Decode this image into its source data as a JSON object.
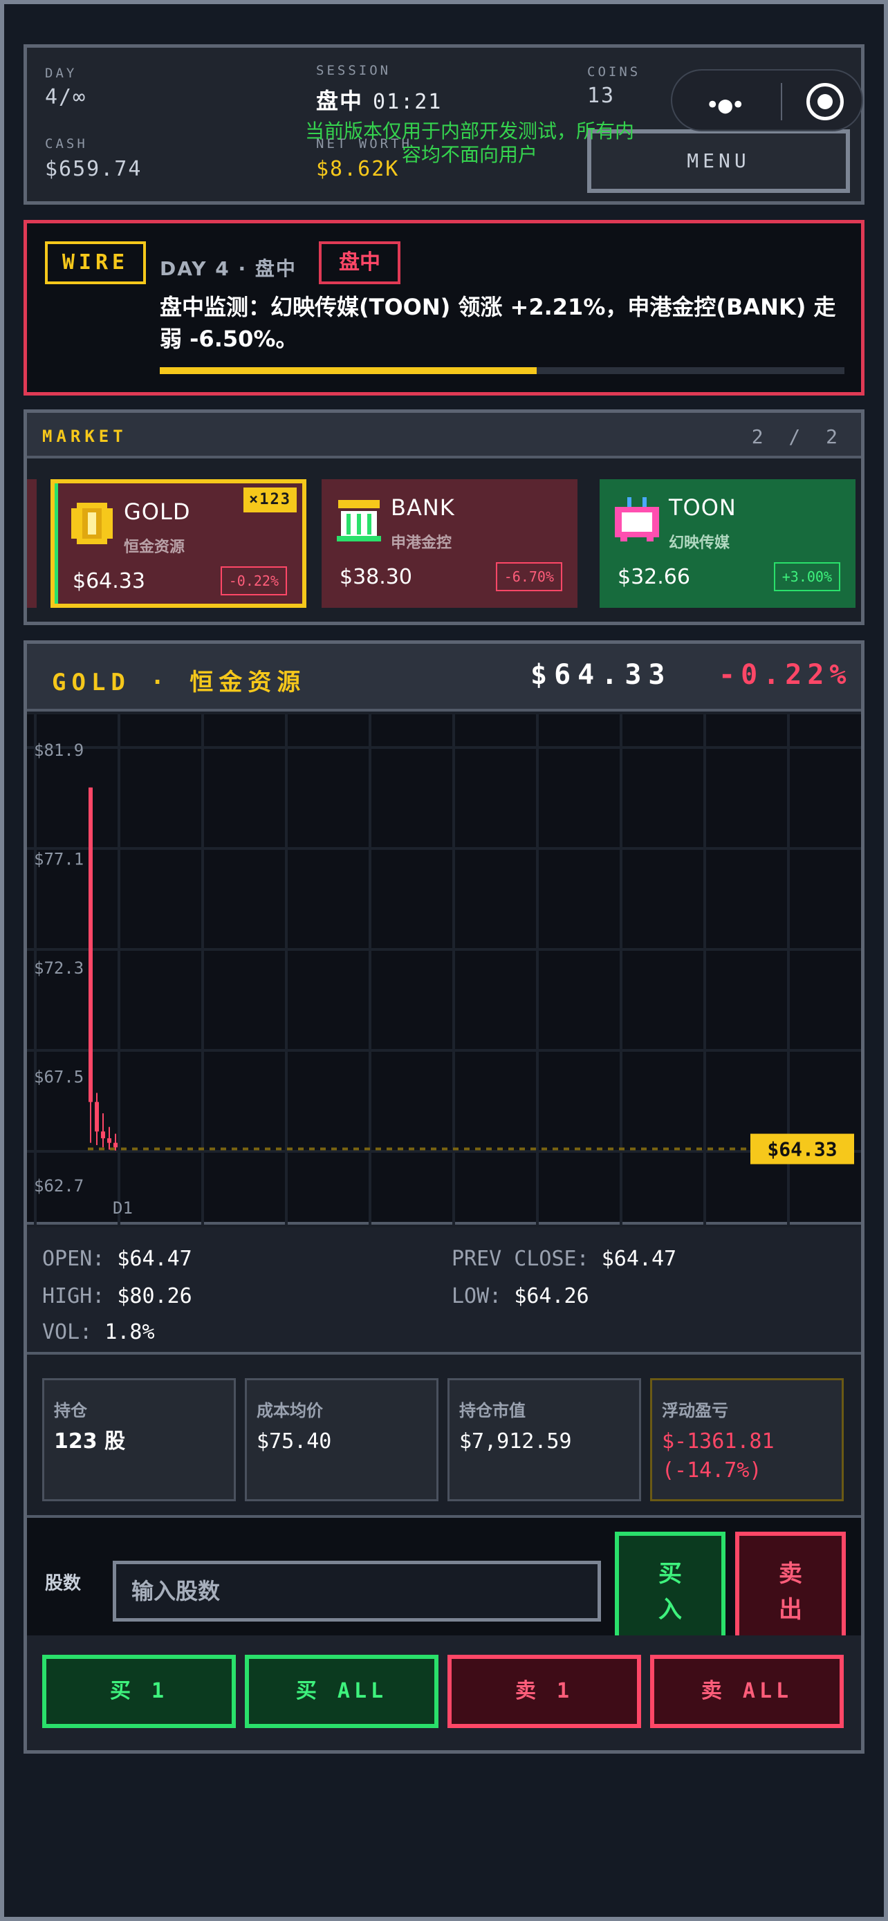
{
  "status": {
    "day_label": "DAY",
    "day_value": "4/∞",
    "session_label": "SESSION",
    "session_value": "盘中",
    "clock": "01:21",
    "coins_label": "COINS",
    "coins_value": "13",
    "cash_label": "CASH",
    "cash_value": "$659.74",
    "networth_label": "NET WORTH",
    "networth_value": "$8.62K",
    "menu_label": "MENU",
    "dev_note": "当前版本仅用于内部开发测试，所有内容均不面向用户"
  },
  "wire": {
    "tag": "WIRE",
    "day": "DAY 4 · 盘中",
    "session_badge": "盘中",
    "message": "盘中监测：幻映传媒(TOON) 领涨 +2.21%，申港金控(BANK) 走弱 -6.50%。",
    "progress": 0.55
  },
  "market": {
    "title": "MARKET",
    "page": "2 / 2",
    "cards": [
      {
        "symbol": "GOLD",
        "name": "恒金资源",
        "price": "$64.33",
        "change": "-0.22%",
        "qty": "×123",
        "icon": "gold-coin-icon"
      },
      {
        "symbol": "BANK",
        "name": "申港金控",
        "price": "$38.30",
        "change": "-6.70%",
        "icon": "bank-building-icon"
      },
      {
        "symbol": "TOON",
        "name": "幻映传媒",
        "price": "$32.66",
        "change": "+3.00%",
        "icon": "tv-icon"
      }
    ]
  },
  "stock": {
    "title": "GOLD · 恒金资源",
    "price": "$64.33",
    "change": "-0.22%",
    "open_label": "OPEN:",
    "open": "$64.47",
    "prev_label": "PREV CLOSE:",
    "prev": "$64.47",
    "high_label": "HIGH:",
    "high": "$80.26",
    "low_label": "LOW:",
    "low": "$64.26",
    "vol_label": "VOL:",
    "vol": "1.8%",
    "positions": [
      {
        "label": "持仓",
        "value": "123 股"
      },
      {
        "label": "成本均价",
        "value": "$75.40"
      },
      {
        "label": "持仓市值",
        "value": "$7,912.59"
      },
      {
        "label": "浮动盈亏",
        "value": "$-1361.81 (-14.7%)"
      }
    ],
    "trade": {
      "shares_label": "股数",
      "input_placeholder": "输入股数",
      "buy": "买入",
      "sell": "卖出"
    },
    "quick": [
      "买 1",
      "买 ALL",
      "卖 1",
      "卖 ALL"
    ]
  },
  "chart_data": {
    "type": "candlestick",
    "y_ticks": [
      "$81.9",
      "$77.1",
      "$72.3",
      "$67.5",
      "$62.7"
    ],
    "ylim": [
      62.7,
      81.9
    ],
    "x_ticks": [
      "D1"
    ],
    "last_price_label": "$64.33",
    "last_price": 64.33,
    "candles": [
      {
        "open": 80.26,
        "close": 66.4,
        "high": 80.26,
        "low": 64.6
      },
      {
        "open": 66.4,
        "close": 65.1,
        "high": 66.8,
        "low": 64.5
      },
      {
        "open": 65.1,
        "close": 64.8,
        "high": 65.9,
        "low": 64.4
      },
      {
        "open": 64.8,
        "close": 64.6,
        "high": 65.3,
        "low": 64.3
      },
      {
        "open": 64.6,
        "close": 64.4,
        "high": 65.0,
        "low": 64.26
      }
    ],
    "colors": {
      "down": "#ff4767",
      "up": "#2ae06b",
      "last": "#f6c81b"
    }
  }
}
